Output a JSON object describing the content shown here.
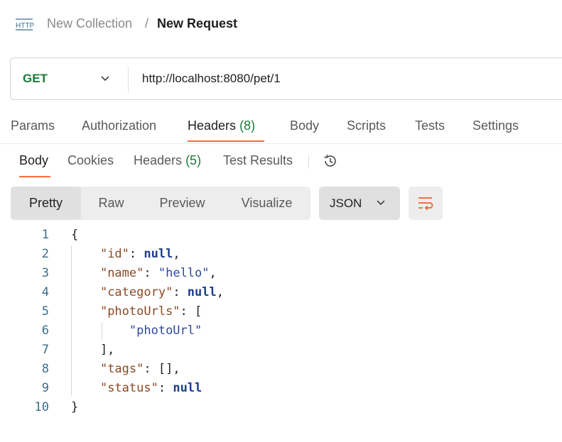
{
  "breadcrumb": {
    "collection": "New Collection",
    "separator": "/",
    "request": "New Request"
  },
  "request": {
    "method": "GET",
    "url": "http://localhost:8080/pet/1",
    "method_color": "#1f7a3a"
  },
  "request_tabs": [
    {
      "label": "Params"
    },
    {
      "label": "Authorization"
    },
    {
      "label": "Headers",
      "count": "(8)",
      "active": true
    },
    {
      "label": "Body"
    },
    {
      "label": "Scripts"
    },
    {
      "label": "Tests"
    },
    {
      "label": "Settings"
    }
  ],
  "response_tabs": [
    {
      "label": "Body",
      "active": true
    },
    {
      "label": "Cookies"
    },
    {
      "label": "Headers",
      "count": "(5)"
    },
    {
      "label": "Test Results"
    }
  ],
  "view_modes": [
    {
      "label": "Pretty",
      "active": true
    },
    {
      "label": "Raw"
    },
    {
      "label": "Preview"
    },
    {
      "label": "Visualize"
    }
  ],
  "format": {
    "label": "JSON"
  },
  "icons": {
    "http": "http-icon",
    "history": "history-icon",
    "wrap": "wrap-lines-icon",
    "chevron": "chevron-down-icon"
  },
  "accent_color": "#ff6c37",
  "code": [
    {
      "n": "1",
      "p": [
        [
          "pun",
          "{"
        ]
      ]
    },
    {
      "n": "2",
      "p": [
        [
          "pun",
          "    "
        ],
        [
          "key",
          "\"id\""
        ],
        [
          "pun",
          ": "
        ],
        [
          "kw",
          "null"
        ],
        [
          "pun",
          ","
        ]
      ]
    },
    {
      "n": "3",
      "p": [
        [
          "pun",
          "    "
        ],
        [
          "key",
          "\"name\""
        ],
        [
          "pun",
          ": "
        ],
        [
          "str",
          "\"hello\""
        ],
        [
          "pun",
          ","
        ]
      ]
    },
    {
      "n": "4",
      "p": [
        [
          "pun",
          "    "
        ],
        [
          "key",
          "\"category\""
        ],
        [
          "pun",
          ": "
        ],
        [
          "kw",
          "null"
        ],
        [
          "pun",
          ","
        ]
      ]
    },
    {
      "n": "5",
      "p": [
        [
          "pun",
          "    "
        ],
        [
          "key",
          "\"photoUrls\""
        ],
        [
          "pun",
          ": ["
        ]
      ]
    },
    {
      "n": "6",
      "p": [
        [
          "pun",
          "        "
        ],
        [
          "str",
          "\"photoUrl\""
        ]
      ]
    },
    {
      "n": "7",
      "p": [
        [
          "pun",
          "    ],"
        ]
      ]
    },
    {
      "n": "8",
      "p": [
        [
          "pun",
          "    "
        ],
        [
          "key",
          "\"tags\""
        ],
        [
          "pun",
          ": [],"
        ]
      ]
    },
    {
      "n": "9",
      "p": [
        [
          "pun",
          "    "
        ],
        [
          "key",
          "\"status\""
        ],
        [
          "pun",
          ": "
        ],
        [
          "kw",
          "null"
        ]
      ]
    },
    {
      "n": "10",
      "p": [
        [
          "pun",
          "}"
        ]
      ]
    }
  ]
}
